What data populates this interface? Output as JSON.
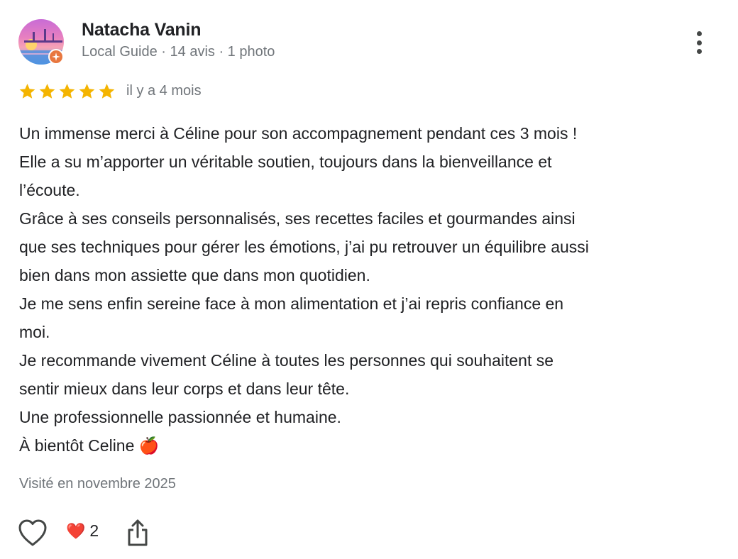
{
  "reviewer": {
    "name": "Natacha Vanin",
    "meta": "Local Guide · 14 avis · 1 photo"
  },
  "rating": {
    "stars": 5,
    "max": 5,
    "time": "il y a 4 mois",
    "star_color": "#f4b400"
  },
  "review": {
    "lines": [
      "Un immense merci à Céline pour son accompagnement pendant ces 3 mois !",
      "Elle a su m’apporter un véritable soutien, toujours dans la bienveillance et",
      "l’écoute.",
      "Grâce à ses conseils personnalisés, ses recettes faciles et gourmandes ainsi",
      "que ses techniques pour gérer les émotions, j’ai pu retrouver un équilibre aussi",
      "bien dans mon assiette que dans mon quotidien.",
      "Je me sens enfin sereine face à mon alimentation et j’ai repris confiance en",
      "moi.",
      "Je recommande vivement Céline à toutes les personnes qui souhaitent se",
      "sentir mieux dans leur corps et dans leur tête.",
      "Une professionnelle passionnée et humaine.",
      "À bientôt Celine 🍎"
    ]
  },
  "visited": "Visité en novembre 2025",
  "actions": {
    "reaction_emoji": "❤️",
    "reaction_count": "2"
  },
  "icons": {
    "like": "heart-outline-icon",
    "share": "share-icon",
    "more": "more-vertical-icon",
    "badge": "local-guide-star-icon"
  }
}
